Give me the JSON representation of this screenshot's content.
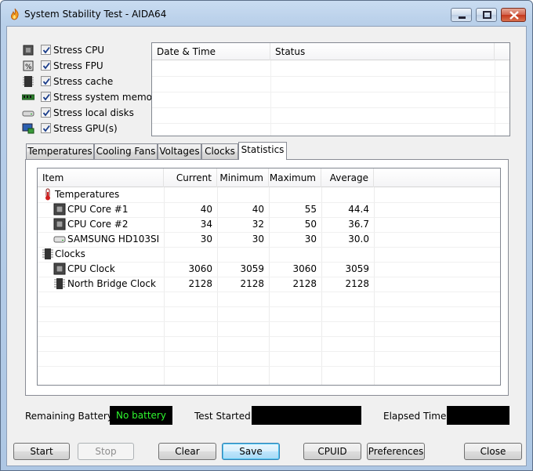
{
  "window": {
    "title": "System Stability Test - AIDA64",
    "controls": [
      "minimize-icon",
      "maximize-icon",
      "close-icon"
    ]
  },
  "stress_options": [
    {
      "label": "Stress CPU",
      "checked": true,
      "icon": "cpu-chip-icon"
    },
    {
      "label": "Stress FPU",
      "checked": true,
      "icon": "fpu-icon"
    },
    {
      "label": "Stress cache",
      "checked": true,
      "icon": "cache-chip-icon"
    },
    {
      "label": "Stress system memory",
      "checked": true,
      "icon": "memory-module-icon"
    },
    {
      "label": "Stress local disks",
      "checked": true,
      "icon": "hard-disk-icon"
    },
    {
      "label": "Stress GPU(s)",
      "checked": true,
      "icon": "gpu-monitor-icon"
    }
  ],
  "log": {
    "columns": [
      "Date & Time",
      "Status"
    ]
  },
  "tabs": [
    {
      "label": "Temperatures",
      "active": false
    },
    {
      "label": "Cooling Fans",
      "active": false
    },
    {
      "label": "Voltages",
      "active": false
    },
    {
      "label": "Clocks",
      "active": false
    },
    {
      "label": "Statistics",
      "active": true
    }
  ],
  "statistics": {
    "columns": [
      "Item",
      "Current",
      "Minimum",
      "Maximum",
      "Average"
    ],
    "rows": [
      {
        "group": true,
        "item": "Temperatures",
        "icon": "thermometer-icon"
      },
      {
        "item": "CPU Core #1",
        "icon": "cpu-chip-icon",
        "current": "40",
        "minimum": "40",
        "maximum": "55",
        "average": "44.4"
      },
      {
        "item": "CPU Core #2",
        "icon": "cpu-chip-icon",
        "current": "34",
        "minimum": "32",
        "maximum": "50",
        "average": "36.7"
      },
      {
        "item": "SAMSUNG HD103SI",
        "icon": "hard-disk-icon",
        "current": "30",
        "minimum": "30",
        "maximum": "30",
        "average": "30.0"
      },
      {
        "group": true,
        "item": "Clocks",
        "icon": "clock-chip-icon"
      },
      {
        "item": "CPU Clock",
        "icon": "cpu-chip-icon",
        "current": "3060",
        "minimum": "3059",
        "maximum": "3060",
        "average": "3059"
      },
      {
        "item": "North Bridge Clock",
        "icon": "northbridge-chip-icon",
        "current": "2128",
        "minimum": "2128",
        "maximum": "2128",
        "average": "2128"
      }
    ]
  },
  "status": {
    "battery_label": "Remaining Battery:",
    "battery_value": "No battery",
    "test_started_label": "Test Started:",
    "test_started_value": "",
    "elapsed_label": "Elapsed Time:",
    "elapsed_value": ""
  },
  "buttons": {
    "start": "Start",
    "stop": "Stop",
    "clear": "Clear",
    "save": "Save",
    "cpuid": "CPUID",
    "preferences": "Preferences",
    "close": "Close"
  },
  "colors": {
    "battery_text": "#2ef52e",
    "status_box": "#000000",
    "titlebar": "#c9dcf1"
  }
}
